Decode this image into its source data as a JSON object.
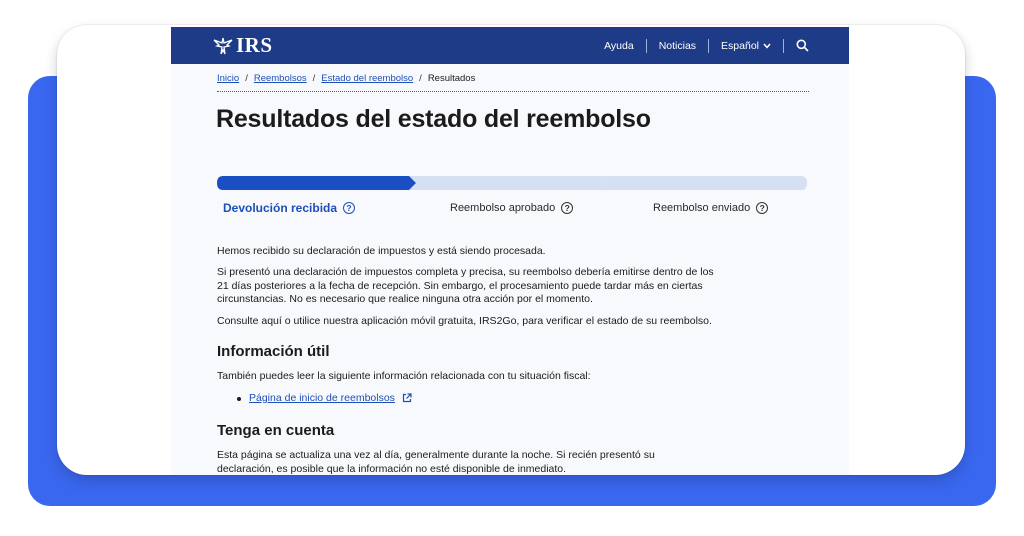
{
  "header": {
    "logo_text": "IRS",
    "nav": {
      "help": "Ayuda",
      "news": "Noticias",
      "language": "Español"
    }
  },
  "breadcrumb": [
    {
      "label": "Inicio"
    },
    {
      "label": "Reembolsos"
    },
    {
      "label": "Estado del reembolso"
    },
    {
      "label": "Resultados"
    }
  ],
  "title": "Resultados del estado del reembolso",
  "progress": {
    "current_step": 1,
    "total_steps": 3,
    "steps": [
      {
        "label": "Devolución recibida",
        "active": true
      },
      {
        "label": "Reembolso aprobado",
        "active": false
      },
      {
        "label": "Reembolso enviado",
        "active": false
      }
    ],
    "help_glyph": "?"
  },
  "body": {
    "p1": "Hemos recibido su declaración de impuestos y está siendo procesada.",
    "p2_line1": "Si presentó una declaración de impuestos completa y precisa, su reembolso debería emitirse dentro de los",
    "p2_line2": "21 días posteriores a la fecha de recepción. Sin embargo, el procesamiento puede tardar más en ciertas",
    "p2_line3": "circunstancias. No es necesario que realice ninguna otra acción por el momento.",
    "p3": "Consulte aquí o utilice nuestra aplicación móvil gratuita, IRS2Go, para verificar el estado de su reembolso.",
    "h_useful": "Información útil",
    "p_useful": "También puedes leer la siguiente información relacionada con tu situación fiscal:",
    "link_refunds": "Página de inicio de reembolsos",
    "h_note": "Tenga en cuenta",
    "p_note_line1": "Esta página se actualiza una vez al día, generalmente durante la noche. Si recién presentó su",
    "p_note_line2": "declaración, es posible que la información no esté disponible de inmediato."
  },
  "colors": {
    "header_bg": "#1d3b86",
    "accent": "#1d4fb8",
    "progress_active": "#1a4fc4",
    "progress_inactive": "#d6e0f3",
    "frame_blue": "#3a67ef"
  },
  "icons": [
    "eagle-logo-icon",
    "chevron-down-icon",
    "search-icon",
    "help-circle-icon",
    "external-link-icon"
  ]
}
